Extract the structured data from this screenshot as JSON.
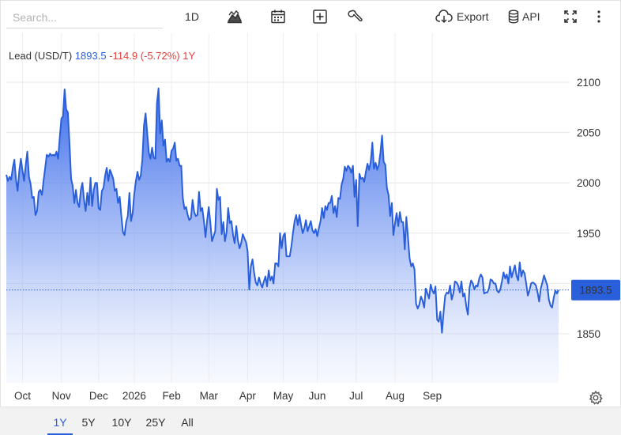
{
  "toolbar": {
    "search_placeholder": "Search...",
    "interval_label": "1D",
    "export_label": "Export",
    "api_label": "API",
    "icons": [
      "mountain-chart-icon",
      "calendar-icon",
      "plus-square-icon",
      "wrench-icon",
      "cloud-download-icon",
      "database-icon",
      "fullscreen-icon",
      "more-vertical-icon"
    ]
  },
  "legend": {
    "symbol": "Lead (USD/T)",
    "last": "1893.5",
    "change": "-114.9",
    "percent": "(-5.72%)",
    "period": "1Y"
  },
  "last_price_label": "1893.5",
  "colors": {
    "line": "#2a5fdb",
    "area_top": "#2f62e8",
    "price_tag": "#2a5fdb",
    "negative": "#e0403a"
  },
  "range_buttons": [
    "1Y",
    "5Y",
    "10Y",
    "25Y",
    "All"
  ],
  "active_range": "1Y",
  "chart_data": {
    "type": "area",
    "title": "",
    "xlabel": "",
    "ylabel": "",
    "y_axis_side": "right",
    "grid": true,
    "ylim": [
      1800,
      2120
    ],
    "y_ticks": [
      1850,
      1900,
      1950,
      2000,
      2050,
      2100
    ],
    "x_ticks": [
      {
        "label": "Oct",
        "t": 10
      },
      {
        "label": "Nov",
        "t": 34
      },
      {
        "label": "Dec",
        "t": 57
      },
      {
        "label": "2026",
        "t": 79
      },
      {
        "label": "Feb",
        "t": 102
      },
      {
        "label": "Mar",
        "t": 125
      },
      {
        "label": "Apr",
        "t": 149
      },
      {
        "label": "May",
        "t": 171
      },
      {
        "label": "Jun",
        "t": 192
      },
      {
        "label": "Jul",
        "t": 216
      },
      {
        "label": "Aug",
        "t": 240
      },
      {
        "label": "Sep",
        "t": 263
      }
    ],
    "last_value": 1893.5,
    "series": [
      {
        "values": [
          2008,
          2002,
          2006,
          2003,
          2015,
          2023,
          2003,
          1992,
          2012,
          2024,
          2012,
          2002,
          2018,
          2031,
          2006,
          1999,
          1985,
          1986,
          1968,
          1972,
          1991,
          1993,
          1988,
          2002,
          2015,
          2028,
          2026,
          2029,
          2027,
          2028,
          2027,
          2031,
          2024,
          2045,
          2064,
          2066,
          2093,
          2073,
          2070,
          2040,
          2004,
          1997,
          1980,
          1993,
          1980,
          1976,
          1993,
          2000,
          1983,
          1972,
          1990,
          1978,
          2005,
          1977,
          1993,
          2000,
          2000,
          1975,
          1973,
          1992,
          1995,
          2007,
          2015,
          2002,
          2013,
          2009,
          2004,
          1992,
          1994,
          1980,
          1986,
          1968,
          1951,
          1948,
          1961,
          1967,
          1990,
          1962,
          1970,
          1989,
          2002,
          2011,
          2003,
          2007,
          2023,
          2057,
          2069,
          2050,
          2030,
          2024,
          2035,
          2025,
          2024,
          2079,
          2094,
          2049,
          2062,
          2037,
          2043,
          2021,
          2024,
          2021,
          2032,
          2034,
          2040,
          2022,
          2024,
          2017,
          2017,
          1985,
          1974,
          1976,
          1968,
          1963,
          1965,
          1983,
          1971,
          1967,
          1968,
          1991,
          1972,
          1975,
          1962,
          1946,
          1963,
          1976,
          1960,
          1942,
          1947,
          1952,
          1994,
          1983,
          1986,
          1949,
          1961,
          1942,
          1951,
          1975,
          1960,
          1962,
          1948,
          1940,
          1957,
          1943,
          1935,
          1940,
          1949,
          1945,
          1941,
          1932,
          1894,
          1917,
          1924,
          1911,
          1901,
          1898,
          1906,
          1900,
          1896,
          1902,
          1907,
          1897,
          1913,
          1903,
          1907,
          1900,
          1920,
          1920,
          1917,
          1950,
          1935,
          1947,
          1950,
          1927,
          1927,
          1927,
          1937,
          1950,
          1962,
          1968,
          1958,
          1968,
          1958,
          1950,
          1955,
          1963,
          1952,
          1957,
          1962,
          1953,
          1950,
          1954,
          1947,
          1955,
          1962,
          1975,
          1965,
          1977,
          1973,
          1980,
          1980,
          1987,
          1970,
          1977,
          1966,
          1985,
          1984,
          1998,
          2004,
          2016,
          2012,
          2017,
          2015,
          2010,
          2017,
          1986,
          2003,
          1957,
          2009,
          2004,
          2005,
          2001,
          2011,
          2019,
          2013,
          2021,
          2040,
          2014,
          2020,
          2013,
          2018,
          2030,
          2047,
          2021,
          2018,
          1995,
          1988,
          1967,
          1980,
          1948,
          1960,
          1970,
          1957,
          1971,
          1961,
          1961,
          1934,
          1966,
          1946,
          1925,
          1917,
          1920,
          1914,
          1880,
          1875,
          1879,
          1887,
          1883,
          1876,
          1895,
          1890,
          1885,
          1899,
          1893,
          1890,
          1897,
          1864,
          1862,
          1872,
          1851,
          1872,
          1888,
          1891,
          1890,
          1898,
          1884,
          1890,
          1902,
          1901,
          1898,
          1891,
          1902,
          1887,
          1890,
          1877,
          1869,
          1896,
          1903,
          1900,
          1894,
          1898,
          1897,
          1905,
          1909,
          1906,
          1890,
          1891,
          1891,
          1895,
          1904,
          1903,
          1900,
          1900,
          1893,
          1891,
          1894,
          1902,
          1911,
          1905,
          1909,
          1900,
          1917,
          1906,
          1912,
          1918,
          1908,
          1903,
          1921,
          1907,
          1913,
          1910,
          1900,
          1888,
          1893,
          1900,
          1901,
          1900,
          1898,
          1891,
          1882,
          1895,
          1901,
          1908,
          1903,
          1898,
          1884,
          1878,
          1876,
          1886,
          1893,
          1890,
          1893.5
        ]
      }
    ]
  }
}
